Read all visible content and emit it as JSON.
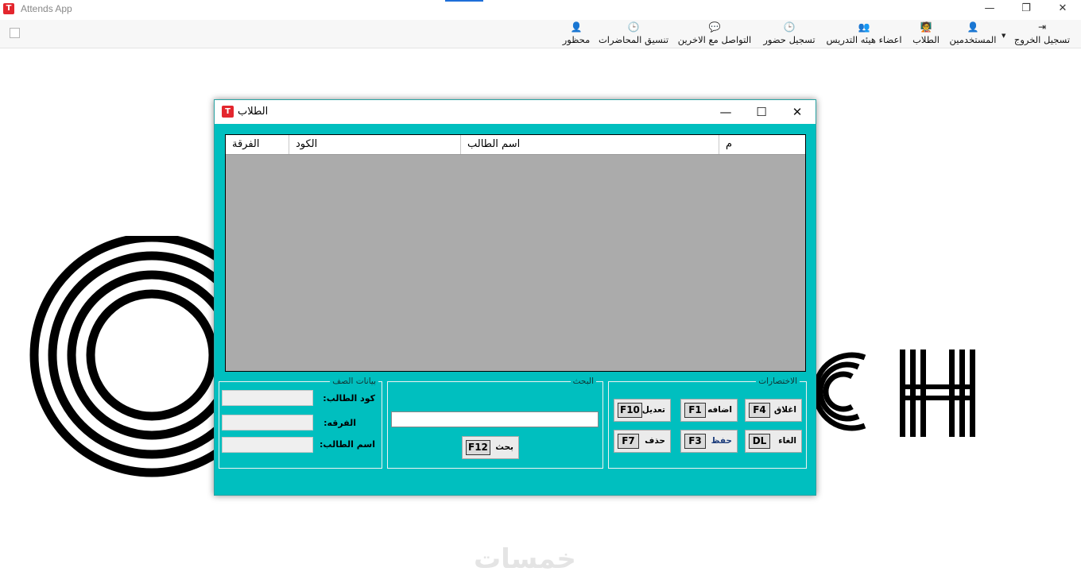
{
  "app": {
    "title": "Attends App",
    "window_controls": {
      "minimize": "—",
      "restore": "❐",
      "close": "✕"
    }
  },
  "ribbon": {
    "items": [
      {
        "key": "logout",
        "label": "تسجيل الخروج",
        "icon": "logout-icon",
        "glyph": "⇥"
      },
      {
        "key": "users",
        "label": "المستخدمين",
        "icon": "user-icon",
        "glyph": "👤",
        "dropdown_glyph": "▼"
      },
      {
        "key": "students",
        "label": "الطلاب",
        "icon": "students-board-icon",
        "glyph": "🧑‍🏫"
      },
      {
        "key": "staff",
        "label": "اعضاء هيئه التدريس",
        "icon": "group-icon",
        "glyph": "👥"
      },
      {
        "key": "attendance",
        "label": "تسجيل حضور",
        "icon": "clock-icon",
        "glyph": "🕒"
      },
      {
        "key": "contact",
        "label": "التواصل مع الاخرين",
        "icon": "chat-icon",
        "glyph": "💬"
      },
      {
        "key": "lectures",
        "label": "تنسيق المحاضرات",
        "icon": "clock-icon",
        "glyph": "🕒"
      },
      {
        "key": "banned",
        "label": "محظور",
        "icon": "banned-user-icon",
        "glyph": "👤"
      }
    ]
  },
  "background": {
    "logo_letters": "CH",
    "watermark": "خمسات"
  },
  "dialog": {
    "title": "الطلاب",
    "controls": {
      "minimize": "—",
      "maximize": "☐",
      "close": "✕"
    },
    "table": {
      "columns": [
        "م",
        "اسم الطالب",
        "الكود",
        "الفرقة"
      ],
      "rows": []
    },
    "class_data": {
      "title": "بيانات الصف",
      "fields": [
        {
          "label": "كود الطالب:",
          "value": ""
        },
        {
          "label": "الفرقه:",
          "value": ""
        },
        {
          "label": "اسم الطالب:",
          "value": ""
        }
      ]
    },
    "search": {
      "title": "البحث",
      "value": "",
      "button_label": "بحث",
      "button_key": "F12"
    },
    "shortcuts": {
      "title": "الاختصارات",
      "buttons": [
        {
          "label": "اغلاق",
          "key": "F4"
        },
        {
          "label": "اضافه",
          "key": "F1"
        },
        {
          "label": "تعديل",
          "key": "F10"
        },
        {
          "label": "الغاء",
          "key": "DL"
        },
        {
          "label": "حفظ",
          "key": "F3"
        },
        {
          "label": "حذف",
          "key": "F7"
        }
      ]
    }
  }
}
